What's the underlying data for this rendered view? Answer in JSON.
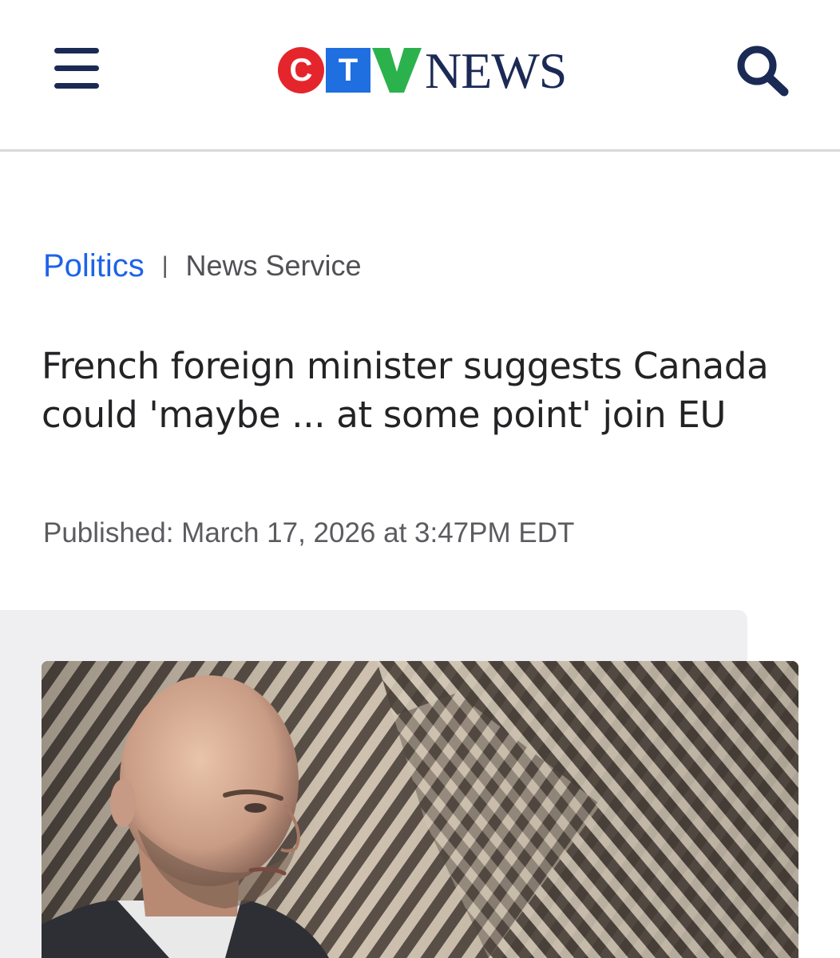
{
  "header": {
    "logo": {
      "letters": [
        "C",
        "T",
        "V"
      ],
      "wordmark": "NEWS"
    },
    "icons": {
      "menu": "hamburger-menu-icon",
      "search": "search-icon"
    },
    "colors": {
      "navy": "#1b2a55",
      "red": "#e4262c",
      "blue": "#1f6fe0",
      "green": "#2bb24c"
    }
  },
  "article": {
    "category": "Politics",
    "separator": "|",
    "source": "News Service",
    "headline": "French foreign minister suggests Canada could 'maybe ... at some point' join EU",
    "published": "Published: March 17, 2026 at 3:47PM EDT"
  },
  "colors": {
    "category_link": "#1f63e8"
  }
}
